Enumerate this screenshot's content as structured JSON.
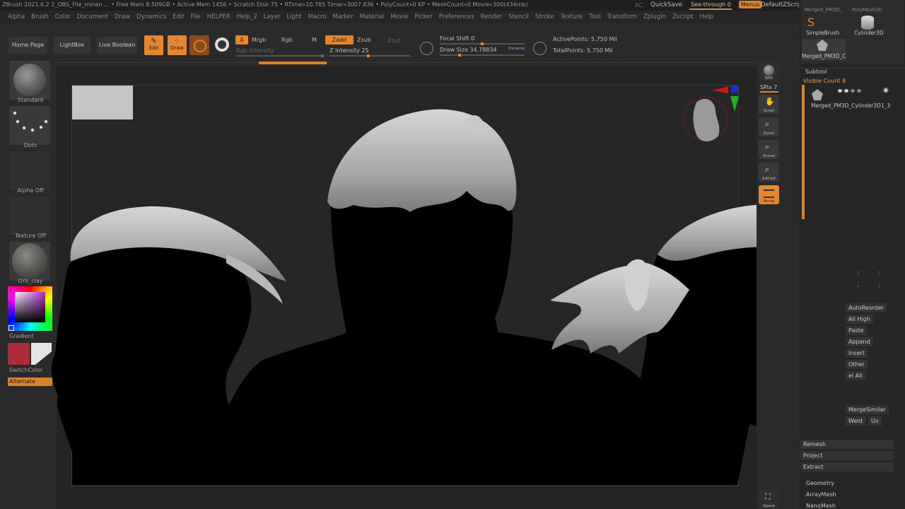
{
  "titlebar": {
    "text": "ZBrush 2021.6.2   1_OBS_File_minen   ... • Free Mem 8.509GB • Active Mem 1456 • Scratch Disk 75 •  RTime»10.785 Timer»3007.836 • PolyCount»0 KP • MeshCount»0  Movie»300(434mb)",
    "ac": "AC",
    "quicksave": "QuickSave",
    "see_through": "See-through  0",
    "menus": "Menus",
    "default_zscript": "DefaultZScript"
  },
  "menu": [
    "Alpha",
    "Brush",
    "Color",
    "Document",
    "Draw",
    "Dynamics",
    "Edit",
    "File",
    "HELPER",
    "Help_2",
    "Layer",
    "Light",
    "Macro",
    "Marker",
    "Material",
    "Movie",
    "Picker",
    "Preferences",
    "Render",
    "Stencil",
    "Stroke",
    "Texture",
    "Tool",
    "Transform",
    "Zplugin",
    "Zscript",
    "Help"
  ],
  "topshelf": {
    "home_page": "Home Page",
    "lightbox": "LightBox",
    "live_boolean": "Live Boolean",
    "edit": "Edit",
    "draw": "Draw",
    "a": "A",
    "mrgb": "Mrgb",
    "rgb": "Rgb",
    "m": "M",
    "rgb_intensity": "Rgb Intensity",
    "zadd": "Zadd",
    "zsub": "Zsub",
    "zcut": "Zcut",
    "z_intensity": "Z Intensity 25",
    "focal_shift": "Focal Shift 0",
    "draw_size": "Draw Size 34.78834",
    "dynamic": "Dynamic",
    "active_points": "ActivePoints: 5.750 Mil",
    "total_points": "TotalPoints: 5.750 Mil",
    "z_intensity_value": 25,
    "draw_size_value": 34.78834
  },
  "leftshelf": {
    "standard": "Standard",
    "dots": "Dots",
    "alpha_off": "Alpha Off",
    "texture_off": "Texture Off",
    "orb_clay": "Orb_clay",
    "gradient": "Gradient",
    "switch_color": "SwitchColor",
    "alternate": "Alternate"
  },
  "rightshelf": {
    "bpr": "BPR",
    "spix": "SPix 7",
    "scroll": "Scroll",
    "zoom": "Zoom",
    "actual": "Actual",
    "aahalf": "AAHalf",
    "persp": "Persp",
    "space": "Space"
  },
  "tray": {
    "top_items": [
      "Merged_PM3D_",
      "PolyMesh3D"
    ],
    "simplebrush": "SimpleBrush",
    "cylinder3d": "Cylinder3D",
    "merged_pm3d": "Merged_PM3D_C",
    "subtool": "Subtool",
    "visible_count": "Visible Count 8",
    "subtool_name": "Merged_PM3D_Cylinder3D1_3",
    "autoreorder": "AutoReorder",
    "all_high": "All High",
    "paste": "Paste",
    "append": "Append",
    "insert": "Insert",
    "other": "Other",
    "del_all": "el All",
    "merge_similar": "MergeSimilar",
    "weld": "Weld",
    "uv": "Uv",
    "remesh": "Remesh",
    "project": "Project",
    "extract": "Extract",
    "geometry": "Geometry",
    "arraymesh": "ArrayMesh",
    "nanomesh": "NanoMesh"
  },
  "colors": {
    "accent": "#e6862f",
    "primary_color": "#b02b38",
    "secondary_color": "#e4e4e4"
  }
}
